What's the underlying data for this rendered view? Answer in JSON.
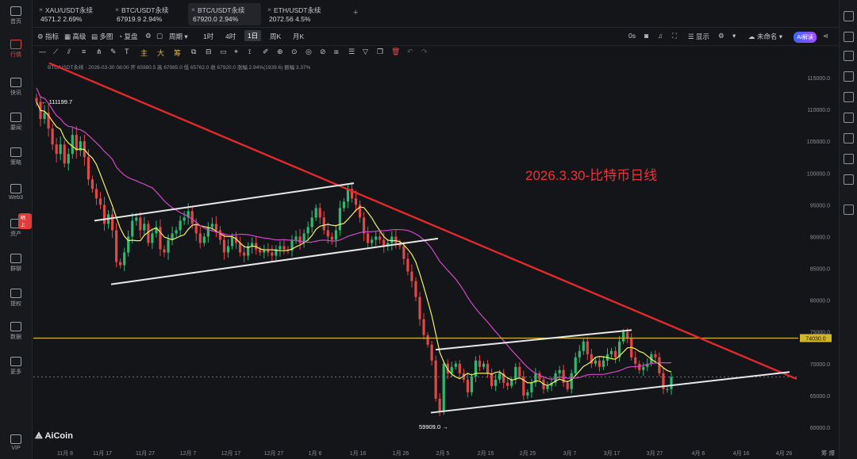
{
  "sidebar": {
    "items": [
      {
        "label": "首页",
        "icon": "home-icon"
      },
      {
        "label": "行情",
        "icon": "market-icon",
        "active": true
      },
      {
        "label": "快讯",
        "icon": "news-flash-icon"
      },
      {
        "label": "要闻",
        "icon": "headlines-icon"
      },
      {
        "label": "策略",
        "icon": "strategy-icon"
      },
      {
        "label": "Web3",
        "icon": "web3-icon"
      },
      {
        "label": "资产",
        "icon": "wallet-icon",
        "badge": "晒上"
      },
      {
        "label": "群聊",
        "icon": "chat-icon"
      },
      {
        "label": "提权",
        "icon": "rights-icon"
      },
      {
        "label": "数据",
        "icon": "data-icon"
      },
      {
        "label": "更多",
        "icon": "more-icon"
      },
      {
        "label": "VIP",
        "icon": "vip-icon"
      }
    ]
  },
  "tabs": [
    {
      "name": "XAU/USDT永续",
      "price": "4571.2",
      "change": "2.69%"
    },
    {
      "name": "BTC/USDT永续",
      "price": "67919.9",
      "change": "2.94%"
    },
    {
      "name": "BTC/USDT永续",
      "price": "67920.0",
      "change": "2.94%",
      "active": true
    },
    {
      "name": "ETH/USDT永续",
      "price": "2072.56",
      "change": "4.5%"
    }
  ],
  "toolbar": {
    "indicator": "指标",
    "advanced": "高级",
    "multi": "多图",
    "replay": "复盘",
    "period": "周期",
    "p1h": "1时",
    "p4h": "4时",
    "p1d": "1日",
    "pweek": "周K",
    "pmonth": "月K",
    "zero_s": "0s",
    "display": "显示",
    "unnamed": "未命名",
    "ai": "AI解读"
  },
  "drawbar": {
    "zhu": "主",
    "da": "大",
    "chou": "筹"
  },
  "info": {
    "text": "BTC/USDT永续 · 2026-03-30 08:00  开 65980.5  高 67985.0  低 65762.0  收 67920.0  涨幅 2.94%(1939.6)  振幅 3.37%"
  },
  "annotation": "2026.3.30-比特币日线",
  "labels": {
    "high": "← 111199.7",
    "low": "59909.0 →",
    "hline": "74030.0"
  },
  "logo": "AiCoin",
  "bottom_right": "筹  爆",
  "chart_data": {
    "type": "candlestick",
    "yaxis": [
      "115000.0",
      "110000.0",
      "105000.0",
      "100000.0",
      "95000.0",
      "90000.0",
      "85000.0",
      "80000.0",
      "75000.0",
      "70000.0",
      "65000.0",
      "60000.0"
    ],
    "xaxis": [
      "11月 8",
      "11月 17",
      "11月 27",
      "12月 7",
      "12月 17",
      "12月 27",
      "1月 6",
      "1月 16",
      "1月 26",
      "2月 5",
      "2月 15",
      "2月 25",
      "3月 7",
      "3月 17",
      "3月 27",
      "4月 6",
      "4月 16",
      "4月 26"
    ],
    "ylim": [
      57500,
      117500
    ],
    "close": [
      111200,
      108500,
      109500,
      107000,
      104500,
      103000,
      104500,
      101500,
      103000,
      106000,
      103500,
      105000,
      102500,
      99000,
      97500,
      96000,
      95000,
      92000,
      93500,
      91000,
      86000,
      85500,
      87500,
      90000,
      92500,
      93000,
      91000,
      92000,
      89000,
      90500,
      91500,
      88000,
      87500,
      89500,
      90500,
      91000,
      92500,
      93000,
      94000,
      92000,
      90500,
      89000,
      90000,
      91500,
      92000,
      91000,
      89500,
      87500,
      88500,
      90000,
      89000,
      87500,
      87000,
      88500,
      89000,
      88000,
      87500,
      88000,
      87500,
      87000,
      88000,
      88500,
      88000,
      87800,
      89500,
      90000,
      89000,
      90500,
      91500,
      93000,
      94500,
      93000,
      91000,
      90000,
      89500,
      91000,
      94500,
      95500,
      97500,
      96000,
      95000,
      93000,
      90500,
      89000,
      89500,
      90000,
      89500,
      88500,
      89000,
      90000,
      89000,
      88500,
      86500,
      84500,
      83000,
      80500,
      77000,
      74500,
      73000,
      70500,
      64500,
      62500,
      70000,
      68500,
      69500,
      70000,
      68500,
      67500,
      65500,
      68000,
      70500,
      69500,
      70000,
      68500,
      66500,
      67500,
      68500,
      67000,
      66500,
      67500,
      69500,
      68000,
      65000,
      65500,
      67000,
      68500,
      67500,
      66000,
      66500,
      67000,
      68500,
      69000,
      67000,
      66000,
      68500,
      71000,
      72000,
      73500,
      71500,
      70000,
      70500,
      69500,
      70500,
      71500,
      72000,
      71000,
      73500,
      75000,
      74000,
      71000,
      70000,
      69000,
      69500,
      70000,
      71500,
      71000,
      68500,
      66000,
      66000,
      67920
    ],
    "ma_fast_color": "#f2f06a",
    "ma_slow_color": "#d147c8",
    "up_color": "#2fb86f",
    "down_color": "#e04747",
    "trend_line_color": "#e2292b",
    "hline_color": "#d4b62b",
    "channel_color": "#e8e8e8"
  }
}
